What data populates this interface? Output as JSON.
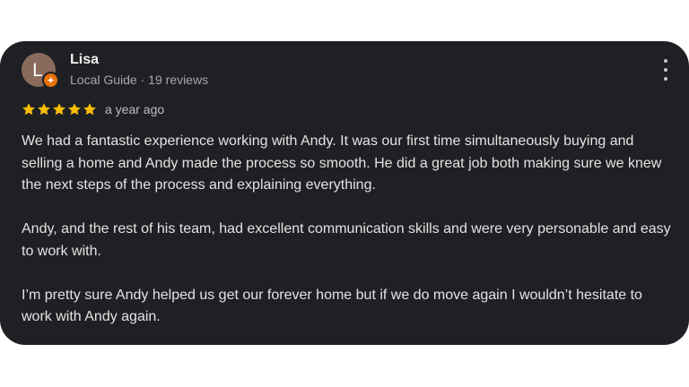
{
  "review": {
    "author": {
      "initial": "L",
      "name": "Lisa",
      "meta": "Local Guide · 19 reviews",
      "avatar_color": "#8a6a5c",
      "badge_color": "#e8710a",
      "badge_icon": "local-guide-star-icon"
    },
    "rating": 5,
    "rating_max": 5,
    "star_color": "#fbbc04",
    "time_ago": "a year ago",
    "paragraphs": [
      "We had a fantastic experience working with Andy. It was our first time simultaneously buying and selling a home and Andy made the process so smooth. He did a great job both making sure we knew the next steps of the process and explaining everything.",
      "Andy, and the rest of his team, had excellent communication skills and were very personable and easy to work with.",
      "I’m pretty sure Andy helped us get our forever home but if we do move again I wouldn’t hesitate to work with Andy again."
    ],
    "more_icon": "more-vertical-icon",
    "card_background": "#1f2024"
  }
}
